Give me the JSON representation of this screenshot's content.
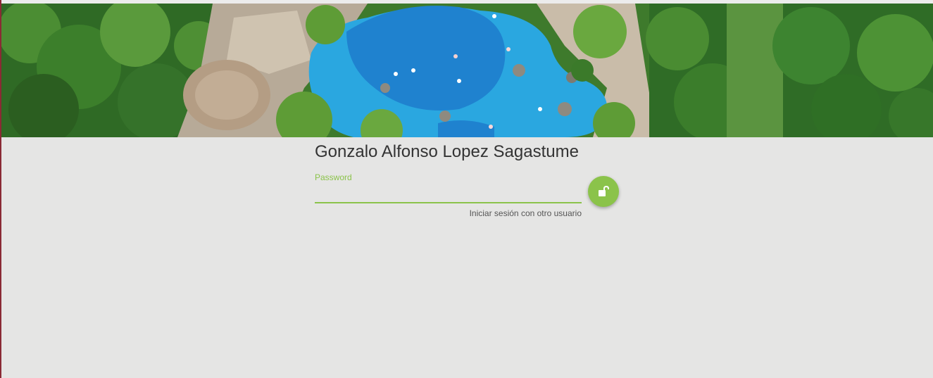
{
  "banner": {
    "alt": "Aerial view of pool surrounded by gardens"
  },
  "login": {
    "user_name": "Gonzalo Alfonso Lopez Sagastume",
    "password_label": "Password",
    "password_value": "",
    "switch_user_link": "Iniciar sesión con otro usuario",
    "unlock_icon": "unlock-icon"
  },
  "colors": {
    "accent": "#8bc34a",
    "background": "#e5e5e4",
    "left_edge": "#8a2a34"
  }
}
